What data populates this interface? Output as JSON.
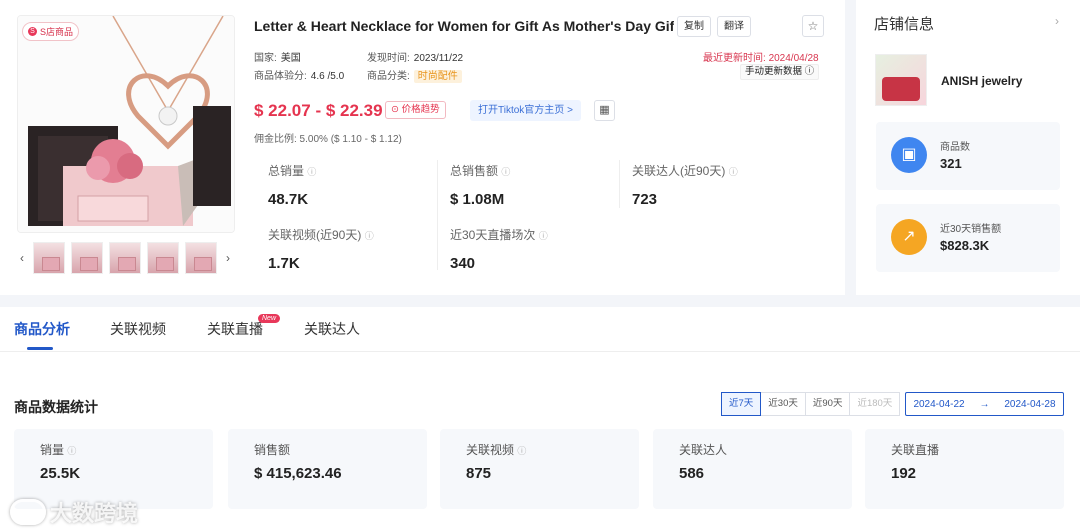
{
  "product": {
    "badge": "S店商品",
    "title": "Letter & Heart Necklace for Women for Gift As Mother's Day Gift,...",
    "copy_label": "复制",
    "translate_label": "翻译",
    "country_label": "国家:",
    "country": "美国",
    "discovered_label": "发现时间:",
    "discovered": "2023/11/22",
    "rating_label": "商品体验分:",
    "rating": "4.6 /5.0",
    "category_label": "商品分类:",
    "category": "时尚配件",
    "updated_label": "最近更新时间:",
    "updated": "2024/04/28",
    "manual_update": "手动更新数据",
    "price": "$ 22.07 - $ 22.39",
    "price_trend": "价格趋势",
    "tiktok_link": "打开Tiktok官方主页 >",
    "commission": "佣金比例: 5.00% ($ 1.10 - $ 1.12)",
    "stats": [
      {
        "label": "总销量",
        "value": "48.7K"
      },
      {
        "label": "总销售额",
        "value": "$ 1.08M"
      },
      {
        "label": "关联达人(近90天)",
        "value": "723"
      },
      {
        "label": "关联视频(近90天)",
        "value": "1.7K"
      },
      {
        "label": "近30天直播场次",
        "value": "340"
      }
    ]
  },
  "shop": {
    "title": "店铺信息",
    "name": "ANISH jewelry",
    "product_count_label": "商品数",
    "product_count": "321",
    "sales_label": "近30天销售额",
    "sales": "$828.3K",
    "colors": {
      "blue": "#3f86f0",
      "orange": "#f5a623"
    }
  },
  "tabs": [
    {
      "label": "商品分析"
    },
    {
      "label": "关联视频"
    },
    {
      "label": "关联直播"
    },
    {
      "label": "关联达人"
    }
  ],
  "new_badge": "New",
  "section": {
    "title": "商品数据统计",
    "ranges": [
      "近7天",
      "近30天",
      "近90天",
      "近180天"
    ],
    "date_start": "2024-04-22",
    "date_arrow": "→",
    "date_end": "2024-04-28",
    "kpis": [
      {
        "label": "销量",
        "value": "25.5K"
      },
      {
        "label": "销售额",
        "value": "$ 415,623.46"
      },
      {
        "label": "关联视频",
        "value": "875"
      },
      {
        "label": "关联达人",
        "value": "586"
      },
      {
        "label": "关联直播",
        "value": "192"
      }
    ]
  },
  "watermark": "大数跨境",
  "accent": "#2258c8",
  "price_color": "#e5344f"
}
